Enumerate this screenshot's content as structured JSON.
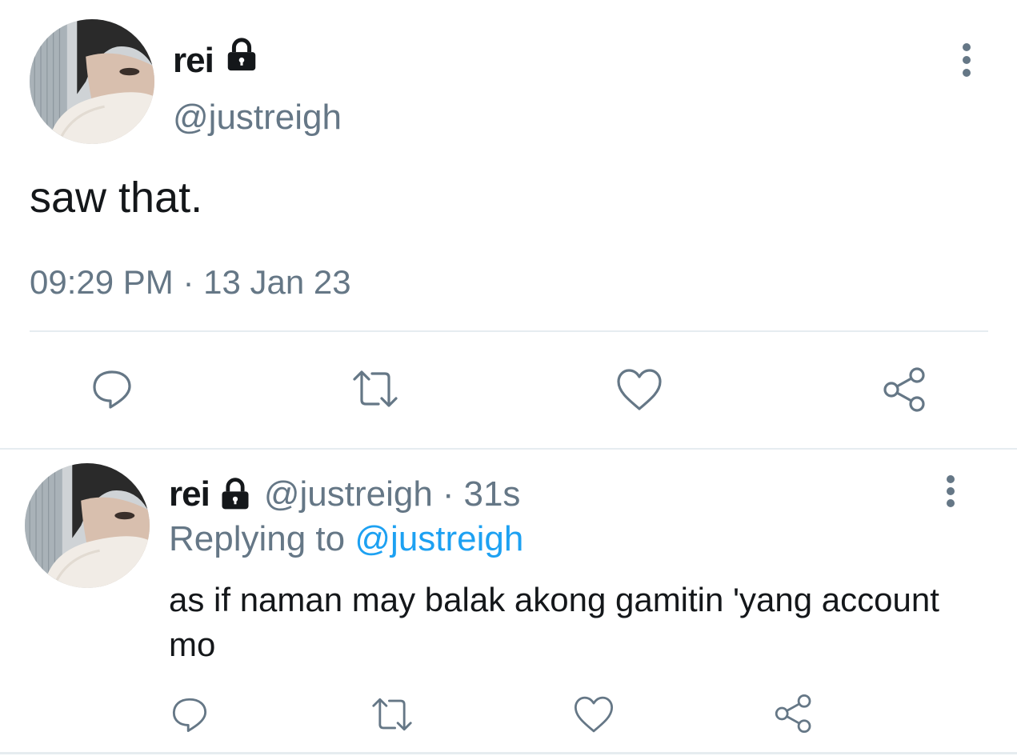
{
  "main_tweet": {
    "display_name": "rei",
    "protected_icon": "lock-icon",
    "handle": "@justreigh",
    "text": "saw that.",
    "timestamp": "09:29 PM · 13 Jan 23",
    "actions": [
      "reply-icon",
      "retweet-icon",
      "like-icon",
      "share-icon"
    ]
  },
  "reply_tweet": {
    "display_name": "rei",
    "protected_icon": "lock-icon",
    "handle": "@justreigh",
    "separator": "·",
    "age": "31s",
    "replying_prefix": "Replying to",
    "replying_to": "@justreigh",
    "text": "as if naman may balak akong gamitin 'yang account mo",
    "actions": [
      "reply-icon",
      "retweet-icon",
      "like-icon",
      "share-icon"
    ]
  },
  "colors": {
    "text": "#14171a",
    "secondary": "#657786",
    "link": "#1da1f2",
    "divider": "#e6ecf0"
  }
}
